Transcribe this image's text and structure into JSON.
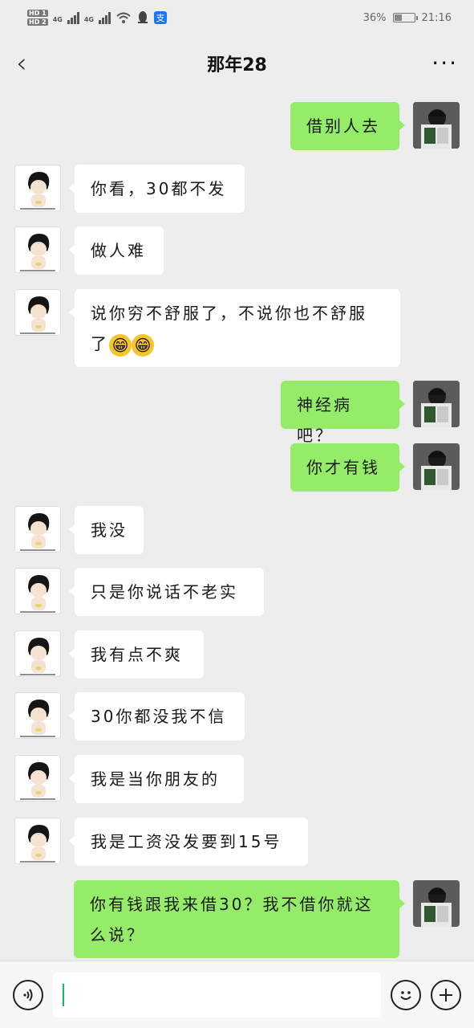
{
  "status": {
    "network": [
      "4G",
      "4G"
    ],
    "sim_labels": [
      "HD 1",
      "HD 2"
    ],
    "battery": "36%",
    "battery_level": 0.36,
    "time": "21:16",
    "icons": [
      "wifi-icon",
      "qq-icon",
      "alipay-icon"
    ]
  },
  "nav": {
    "back_icon": "‹",
    "title": "那年28",
    "more_icon": "···"
  },
  "messages": [
    {
      "side": "right",
      "text": "借别人去"
    },
    {
      "side": "left",
      "text": "你看，30都不发"
    },
    {
      "side": "left",
      "text": "做人难"
    },
    {
      "side": "left",
      "text": "说你穷不舒服了，不说你也不舒服了",
      "emojis": [
        "😁",
        "😁"
      ]
    },
    {
      "side": "right",
      "text": "神经病吧？"
    },
    {
      "side": "right",
      "text": "你才有钱"
    },
    {
      "side": "left",
      "text": "我没"
    },
    {
      "side": "left",
      "text": "只是你说话不老实"
    },
    {
      "side": "left",
      "text": "我有点不爽"
    },
    {
      "side": "left",
      "text": "30你都没我不信"
    },
    {
      "side": "left",
      "text": "我是当你朋友的"
    },
    {
      "side": "left",
      "text": "我是工资没发要到15号"
    },
    {
      "side": "right",
      "text": "你有钱跟我来借30？我不借你就这么说？"
    }
  ],
  "input": {
    "value": "",
    "voice_icon": "voice-icon",
    "emoji_icon": "emoji-icon",
    "plus_icon": "plus-icon"
  },
  "colors": {
    "background": "#ededed",
    "my_bubble": "#95ec69",
    "their_bubble": "#ffffff",
    "caret": "#07c160"
  }
}
